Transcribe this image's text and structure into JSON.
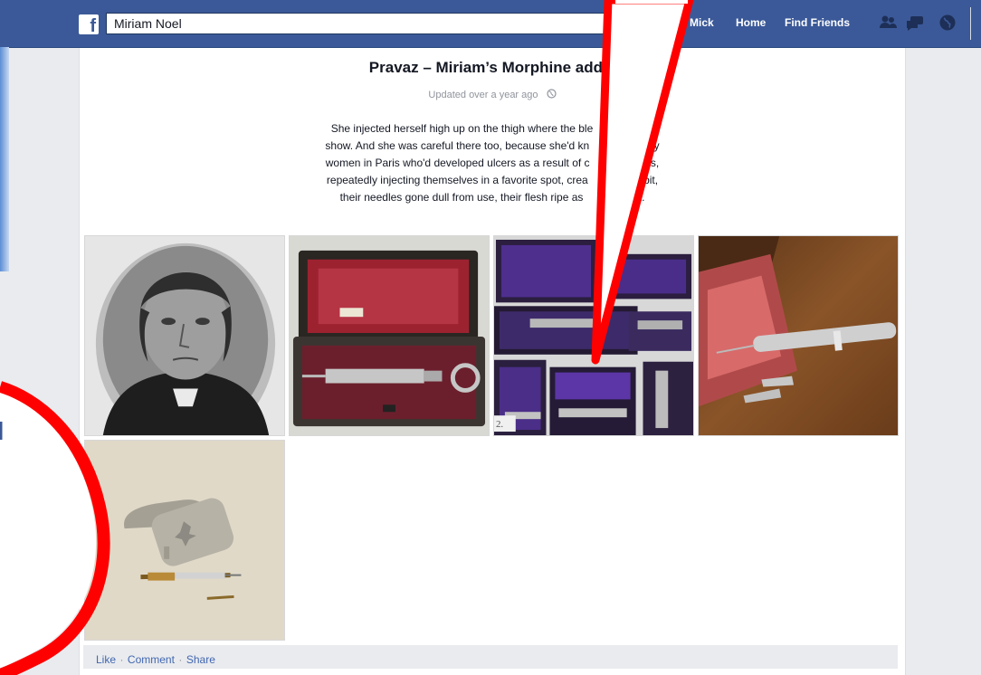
{
  "topbar": {
    "search_value": "Miriam Noel",
    "nav": {
      "profile": "Mick",
      "home": "Home",
      "find_friends": "Find Friends"
    },
    "icons": [
      "friend-requests-icon",
      "messages-icon",
      "notifications-globe-icon"
    ]
  },
  "note": {
    "title": "Pravaz – Miriam’s Morphine addic",
    "updated": "Updated over a year ago",
    "body_lines": [
      "She injected herself high up on the thigh where the ble    dn't",
      "show. And she was careful there too, because she'd kn    many",
      "women in Paris who'd developed ulcers as a result of c    ness,",
      "repeatedly injecting themselves in a favorite spot, crea    habit,",
      "their needles gone dull from use, their flesh ripe as    ruit."
    ],
    "photo_watermark": "2."
  },
  "footer": {
    "like": "Like",
    "comment": "Comment",
    "share": "Share",
    "separator": "·"
  },
  "colors": {
    "facebook_blue": "#3b5998",
    "annotation_red": "#ff0000",
    "link_blue": "#4267b2"
  }
}
